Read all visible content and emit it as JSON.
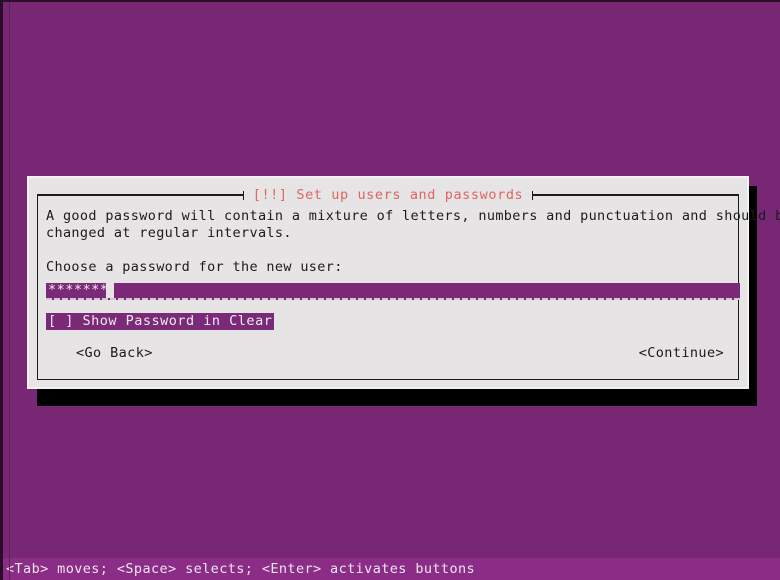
{
  "screen": {
    "background_color": "#762572",
    "frame_color": "#2b0d2a"
  },
  "dialog": {
    "title": "[!!] Set up users and passwords",
    "title_color": "#e0655f",
    "background_color": "#e7e4e6",
    "text_color": "#1b1b1b",
    "paragraph": {
      "line1": "A good password will contain a mixture of letters, numbers and punctuation and should be",
      "line2": "changed at regular intervals."
    },
    "prompt": "Choose a password for the new user:",
    "password_input": {
      "masked_value": "*******",
      "accent_color": "#7b2a77",
      "cursor_visible": "true"
    },
    "show_password": {
      "label": "[ ] Show Password in Clear",
      "checked": "false",
      "highlight_color": "#7b2a77"
    },
    "buttons": {
      "go_back": "<Go Back>",
      "continue": "<Continue>"
    }
  },
  "status_bar": {
    "hint": "<Tab> moves; <Space> selects; <Enter> activates buttons",
    "background_color": "#8b2d86"
  }
}
